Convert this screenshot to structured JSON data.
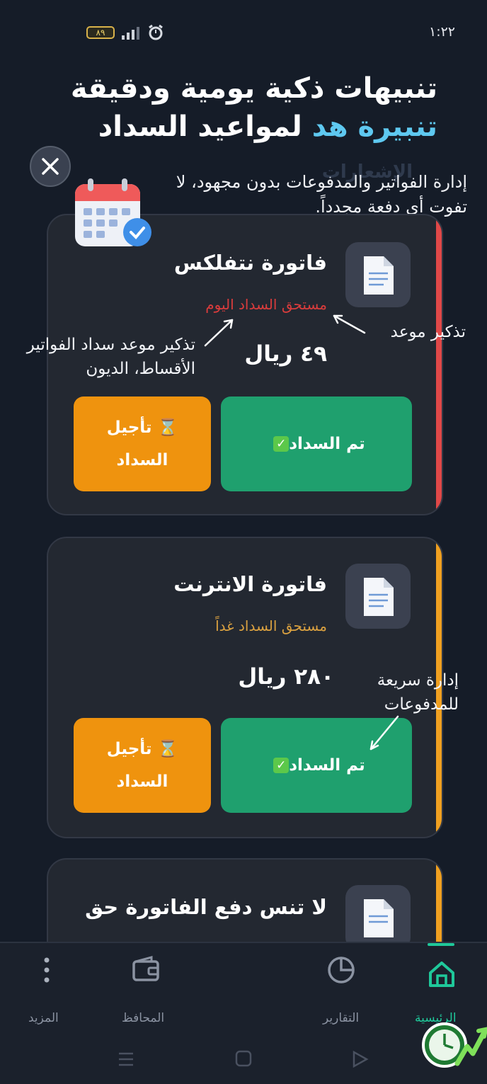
{
  "status_bar": {
    "time": "١:٢٢",
    "battery": "٨٩"
  },
  "hero": {
    "title_line1": "تنبيهات ذكية يومية ودقيقة",
    "title_accent": "تنبيرة هد",
    "title_rest": " لمواعيد السداد",
    "subtitle": "إدارة الفواتير والمدفوعات بدون مجهود، لا تفوت أي دفعة مجدداً.",
    "ghost_text": "الإشعارات"
  },
  "cards": [
    {
      "title": "فاتورة نتفلكس",
      "due": "مستحق السداد اليوم",
      "amount": "٤٩ ريال",
      "paid_label": "تم السداد",
      "defer_label_1": "⌛ تأجيل",
      "defer_label_2": "السداد",
      "accent": "#e04848"
    },
    {
      "title": "فاتورة الانترنت",
      "due": "مستحق السداد غداً",
      "amount": "٢٨٠ ريال",
      "paid_label": "تم السداد",
      "defer_label_1": "⌛ تأجيل",
      "defer_label_2": "السداد",
      "accent": "#f0a020"
    },
    {
      "title": "لا تنس دفع الفاتورة حق",
      "accent": "#f0a020"
    }
  ],
  "annotations": {
    "due_reminder": "تذكير موعد",
    "bills_reminder_1": "تذكير موعد سداد الفواتير",
    "bills_reminder_2": "الأقساط، الديون",
    "quick_manage_1": "إدارة سريعة",
    "quick_manage_2": "للمدفوعات"
  },
  "nav": {
    "items": [
      "الرئيسية",
      "التقارير",
      "المحافظ",
      "المزيد"
    ],
    "active": "الرئيسية"
  },
  "colors": {
    "background": "#151c28",
    "accent": "#1fc89a",
    "paid": "#1fa06e",
    "defer": "#ef930e",
    "overdue": "#e04848",
    "due_soon": "#d9a040"
  }
}
